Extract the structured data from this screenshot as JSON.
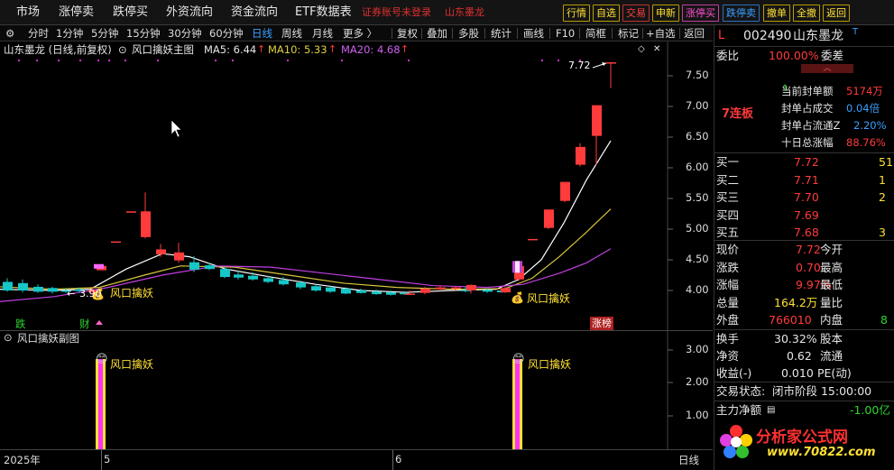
{
  "menu": {
    "items": [
      "市场",
      "涨停卖",
      "跌停买",
      "外资流向",
      "资金流向",
      "ETF数据表"
    ],
    "broker_text": "证券账号未登录",
    "stock_name_red": "山东墨龙",
    "buttons": [
      "行情",
      "自选",
      "交易",
      "申新",
      "涨停买",
      "跌停卖",
      "撤单",
      "全撤",
      "返回"
    ]
  },
  "toolbar": {
    "periods": [
      "分时",
      "1分钟",
      "5分钟",
      "15分钟",
      "30分钟",
      "60分钟",
      "日线",
      "周线",
      "月线",
      "更多 〉"
    ],
    "active_period": "日线",
    "actions": [
      "复权",
      "叠加",
      "多股",
      "统计",
      "画线",
      "F10",
      "简框",
      "标记",
      "+自选",
      "返回"
    ]
  },
  "legend": {
    "title": "山东墨龙 (日线,前复权)",
    "indicator": "风口擒妖主图",
    "ma5": "MA5: 6.44",
    "ma10": "MA10: 5.33",
    "ma20": "MA20: 4.68"
  },
  "main_chart": {
    "y_ticks": [
      "7.50",
      "7.00",
      "6.50",
      "6.00",
      "5.50",
      "5.00",
      "4.50",
      "4.00"
    ],
    "price_top": "7.72",
    "price_low": "3.90",
    "signal_text": "风口擒妖",
    "badges": {
      "die": "跌",
      "cai": "财",
      "zhang": "涨榜"
    },
    "seven_board": "7连板",
    "colors": {
      "up": "#ff3b3b",
      "down": "#16c7c7",
      "ma5": "#ffffff",
      "ma10": "#d8c63a",
      "ma20": "#c040e0",
      "signal": "#ffe033"
    }
  },
  "sub_chart": {
    "title": "风口擒妖副图",
    "y_ticks": [
      "3.00",
      "2.00",
      "1.00"
    ],
    "signal_text": "风口擒妖"
  },
  "xaxis": {
    "labels": [
      "2025年",
      "5",
      "6"
    ],
    "period": "日线"
  },
  "panel": {
    "code": "002490",
    "name": "山东墨龙",
    "name_suffix": "T",
    "market_flag": "L",
    "webi_label": "委比",
    "webi_value": "100.00%",
    "weicha_label": "委差",
    "seal_rows": [
      {
        "label": "当前封单额",
        "value": "5174万"
      },
      {
        "label": "封单占成交",
        "value": "0.04倍"
      },
      {
        "label": "封单占流通Z",
        "value": "2.20%"
      },
      {
        "label": "十日总涨幅",
        "value": "88.76%"
      }
    ],
    "buy_levels": [
      {
        "label": "买一",
        "price": "7.72",
        "vol": "51"
      },
      {
        "label": "买二",
        "price": "7.71",
        "vol": "1"
      },
      {
        "label": "买三",
        "price": "7.70",
        "vol": "2"
      },
      {
        "label": "买四",
        "price": "7.69",
        "vol": ""
      },
      {
        "label": "买五",
        "price": "7.68",
        "vol": "3"
      }
    ],
    "quote_rows": [
      {
        "l1": "现价",
        "v1": "7.72",
        "l2": "今开",
        "v2": ""
      },
      {
        "l1": "涨跌",
        "v1": "0.70",
        "l2": "最高",
        "v2": ""
      },
      {
        "l1": "涨幅",
        "v1": "9.97%",
        "l2": "最低",
        "v2": ""
      },
      {
        "l1": "总量",
        "v1": "164.2万",
        "l2": "量比",
        "v2": ""
      },
      {
        "l1": "外盘",
        "v1": "766010",
        "l2": "内盘",
        "v2": "8"
      }
    ],
    "fin_rows": [
      {
        "l1": "换手",
        "v1": "30.32%",
        "l2": "股本",
        "v2": ""
      },
      {
        "l1": "净资",
        "v1": "0.62",
        "l2": "流通",
        "v2": ""
      },
      {
        "l1": "收益(-)",
        "v1": "0.010",
        "l2": "PE(动)",
        "v2": ""
      }
    ],
    "trade_state_label": "交易状态:",
    "trade_state_value": "闭市阶段 15:00:00",
    "main_flow_label": "主力净额",
    "main_flow_value": "-1.00亿"
  },
  "watermark": {
    "text": "分析家公式网",
    "url": "www.70822.com"
  }
}
